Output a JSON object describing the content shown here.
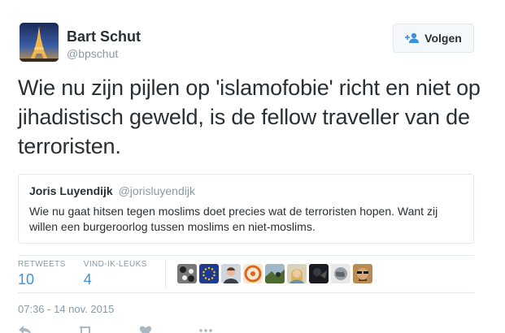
{
  "author": {
    "name": "Bart Schut",
    "handle": "@bpschut",
    "avatar_icon": "eiffel-tower-photo"
  },
  "follow_button": {
    "label": "Volgen",
    "icon": "add-user-icon"
  },
  "tweet": {
    "text": "Wie nu zijn pijlen op 'islamofobie' richt en niet op jihadistisch geweld, is de fellow traveller van de terroristen."
  },
  "quoted_tweet": {
    "name": "Joris Luyendijk",
    "handle": "@jorisluyendijk",
    "text": "Wie nu gaat hitsen tegen moslims doet precies wat de terroristen hopen. Want zij willen een burgeroorlog tussen moslims en niet-moslims."
  },
  "stats": {
    "retweets_label": "RETWEETS",
    "retweets_value": "10",
    "likes_label": "VIND-IK-LEUKS",
    "likes_value": "4"
  },
  "liker_avatars": [
    "bw-pattern",
    "eu-flag",
    "man-portrait",
    "orange-pattern",
    "landscape",
    "woman-portrait",
    "dark-figure",
    "globe",
    "sunglasses-man"
  ],
  "timestamp": "07:36 - 14 nov. 2015",
  "colors": {
    "link_blue": "#3b94d9",
    "muted": "#8899a6",
    "border": "#e1e8ed",
    "text": "#292f33"
  }
}
